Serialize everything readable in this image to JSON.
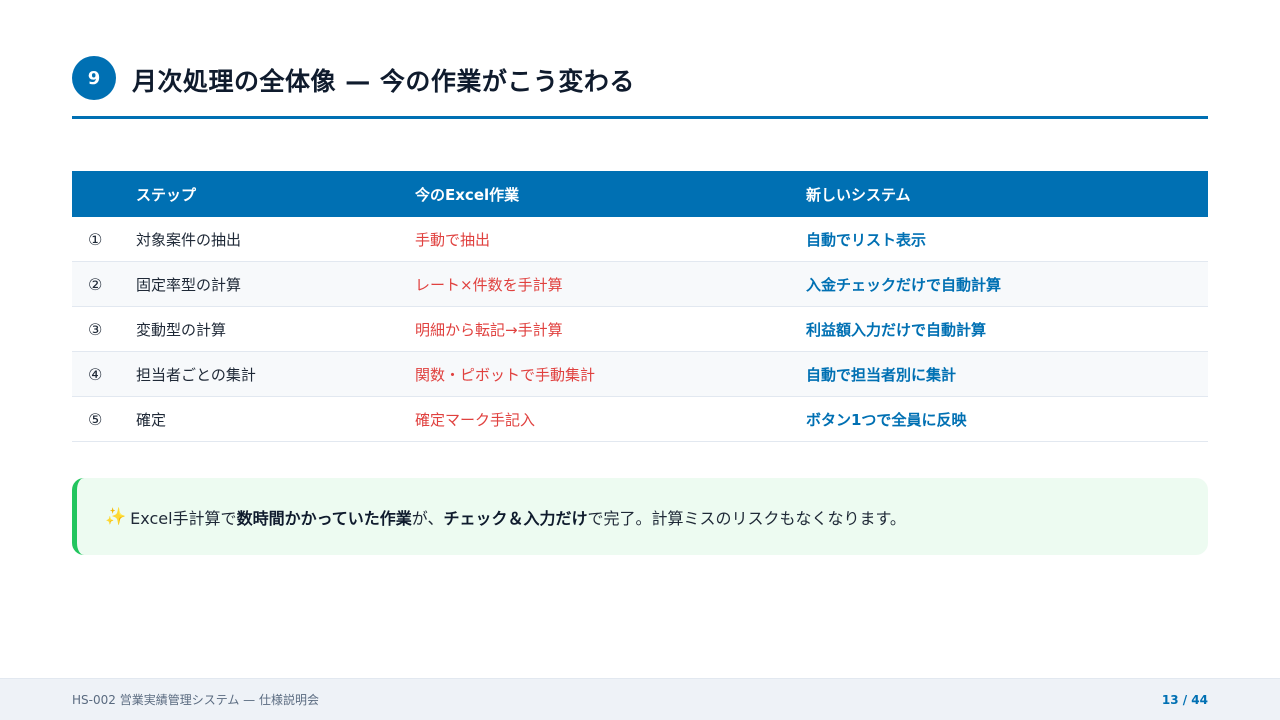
{
  "header": {
    "section_number": "9",
    "title": "月次処理の全体像 — 今の作業がこう変わる"
  },
  "table": {
    "columns": [
      "",
      "ステップ",
      "今のExcel作業",
      "新しいシステム"
    ],
    "rows": [
      {
        "num": "①",
        "step": "対象案件の抽出",
        "old": "手動で抽出",
        "new": "自動でリスト表示"
      },
      {
        "num": "②",
        "step": "固定率型の計算",
        "old": "レート×件数を手計算",
        "new": "入金チェックだけで自動計算"
      },
      {
        "num": "③",
        "step": "変動型の計算",
        "old": "明細から転記→手計算",
        "new": "利益額入力だけで自動計算"
      },
      {
        "num": "④",
        "step": "担当者ごとの集計",
        "old": "関数・ピボットで手動集計",
        "new": "自動で担当者別に集計"
      },
      {
        "num": "⑤",
        "step": "確定",
        "old": "確定マーク手記入",
        "new": "ボタン1つで全員に反映"
      }
    ]
  },
  "callout": {
    "icon": "sparkle-icon",
    "part1": "Excel手計算で",
    "bold1": "数時間かかっていた作業",
    "part2": "が、",
    "bold2": "チェック＆入力だけ",
    "part3": "で完了。計算ミスのリスクもなくなります。"
  },
  "footer": {
    "left": "HS-002 営業実績管理システム — 仕様説明会",
    "page": "13 / 44"
  },
  "colors": {
    "primary": "#0070b3",
    "old_text": "#e0413f",
    "callout_bg": "#edfbf1",
    "callout_border": "#22c55e"
  }
}
